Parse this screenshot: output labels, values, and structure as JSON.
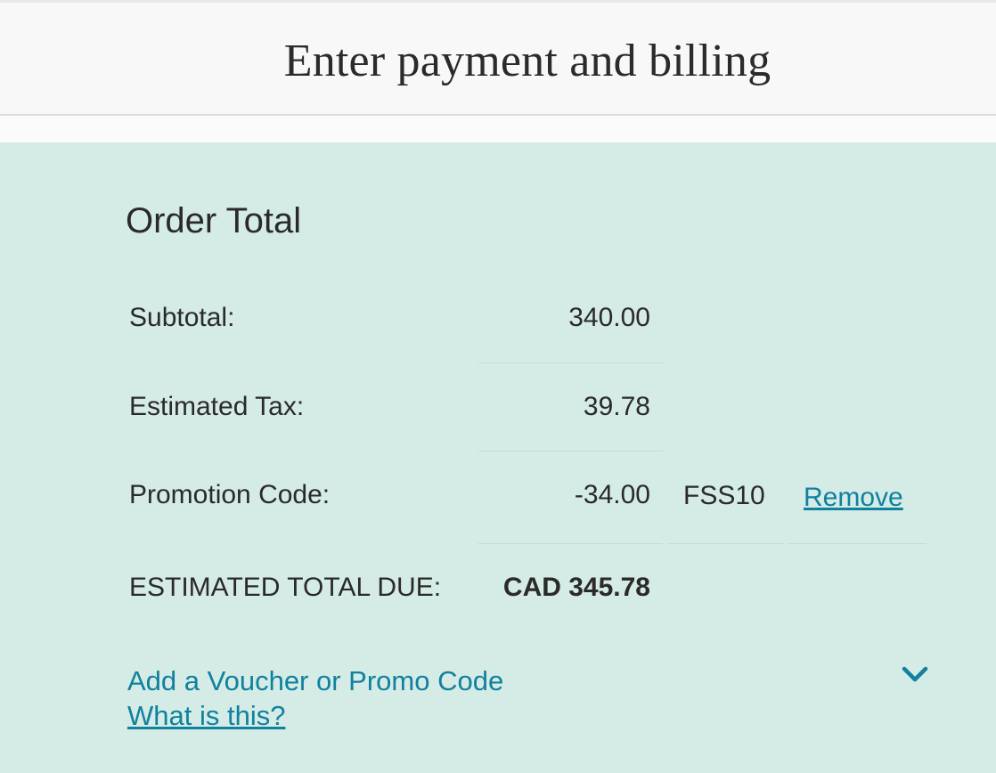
{
  "header": {
    "title": "Enter payment and billing"
  },
  "order_total": {
    "title": "Order Total",
    "rows": [
      {
        "label": "Subtotal:",
        "value": "340.00"
      },
      {
        "label": "Estimated Tax:",
        "value": "39.78"
      },
      {
        "label": "Promotion Code:",
        "value": "-34.00",
        "code": "FSS10",
        "action": "Remove"
      }
    ],
    "total": {
      "label": "ESTIMATED TOTAL DUE:",
      "value": "CAD 345.78"
    }
  },
  "voucher": {
    "label": "Add a Voucher or Promo Code",
    "help_link": "What is this?",
    "toggle_icon": "chevron-down-icon"
  },
  "colors": {
    "panel_bg": "#d5ebe6",
    "header_bg": "#f8f8f8",
    "link": "#10819f",
    "text": "#2a2a2a"
  }
}
